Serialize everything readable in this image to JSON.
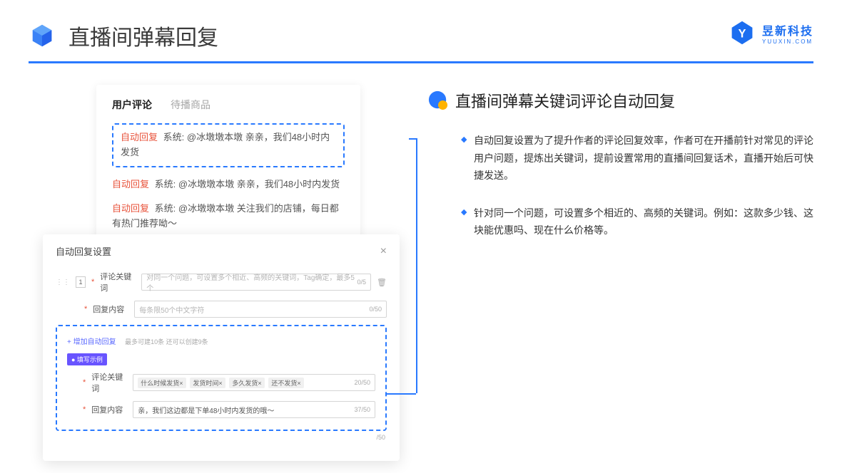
{
  "header": {
    "title": "直播间弹幕回复"
  },
  "brand": {
    "cn": "昱新科技",
    "en": "YUUXIN.COM"
  },
  "comments": {
    "tab_active": "用户评论",
    "tab_inactive": "待播商品",
    "highlighted": {
      "auto": "自动回复",
      "sys": "系统:",
      "text": "@冰墩墩本墩 亲亲，我们48小时内发货"
    },
    "line2": {
      "auto": "自动回复",
      "sys": "系统:",
      "text": "@冰墩墩本墩 亲亲，我们48小时内发货"
    },
    "line3": {
      "auto": "自动回复",
      "sys": "系统:",
      "text": "@冰墩墩本墩 关注我们的店铺，每日都有热门推荐呦～"
    }
  },
  "settings": {
    "title": "自动回复设置",
    "idx": "1",
    "kw_label": "评论关键词",
    "kw_placeholder": "对同一个问题，可设置多个相近、高频的关键词，Tag确定，最多5个",
    "kw_count": "0/5",
    "content_label": "回复内容",
    "content_placeholder": "每条限50个中文字符",
    "content_count": "0/50",
    "add_link": "+ 增加自动回复",
    "add_hint": "最多可建10条 还可以创建9条",
    "example_badge": "● 填写示例",
    "ex_kw_label": "评论关键词",
    "ex_tags": [
      "什么时候发货×",
      "发货时间×",
      "多久发货×",
      "还不发货×"
    ],
    "ex_kw_count": "20/50",
    "ex_content_label": "回复内容",
    "ex_content_value": "亲，我们这边都是下单48小时内发货的哦～",
    "ex_content_count": "37/50",
    "footer_count": "/50"
  },
  "right": {
    "title": "直播间弹幕关键词评论自动回复",
    "p1": "自动回复设置为了提升作者的评论回复效率，作者可在开播前针对常见的评论用户问题，提炼出关键词，提前设置常用的直播间回复话术，直播开始后可快捷发送。",
    "p2": "针对同一个问题，可设置多个相近的、高频的关键词。例如：这款多少钱、这块能优惠吗、现在什么价格等。"
  }
}
